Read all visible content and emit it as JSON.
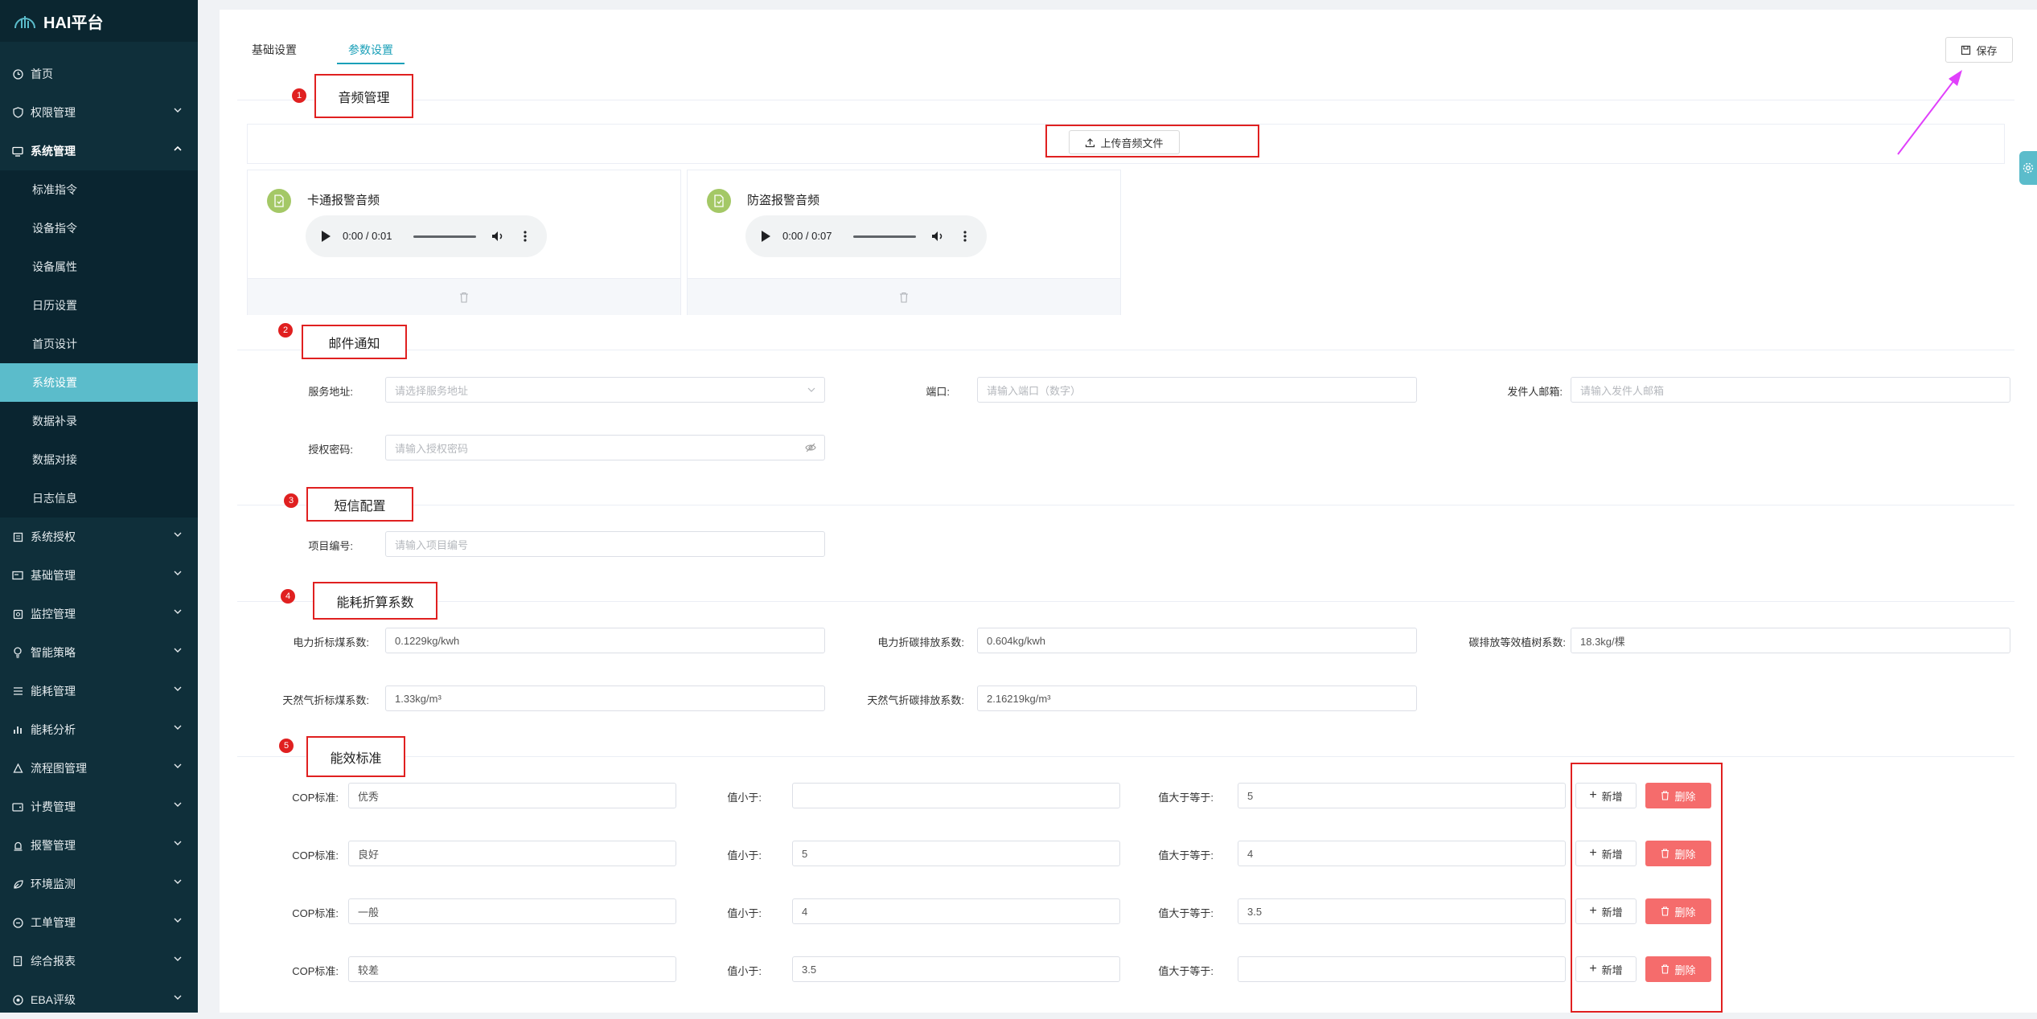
{
  "app": {
    "title": "HAI平台"
  },
  "sidebar": {
    "top_items": [
      {
        "label": "首页",
        "icon": "clock-icon"
      },
      {
        "label": "权限管理",
        "icon": "shield-icon"
      }
    ],
    "open_group": {
      "label": "系统管理",
      "icon": "monitor-icon"
    },
    "sub_items": [
      {
        "label": "标准指令",
        "active": false
      },
      {
        "label": "设备指令",
        "active": false
      },
      {
        "label": "设备属性",
        "active": false
      },
      {
        "label": "日历设置",
        "active": false
      },
      {
        "label": "首页设计",
        "active": false
      },
      {
        "label": "系统设置",
        "active": true
      },
      {
        "label": "数据补录",
        "active": false
      },
      {
        "label": "数据对接",
        "active": false
      },
      {
        "label": "日志信息",
        "active": false
      }
    ],
    "bottom_items": [
      {
        "label": "系统授权",
        "icon": "license-icon"
      },
      {
        "label": "基础管理",
        "icon": "card-icon"
      },
      {
        "label": "监控管理",
        "icon": "camera-icon"
      },
      {
        "label": "智能策略",
        "icon": "bulb-icon"
      },
      {
        "label": "能耗管理",
        "icon": "list-icon"
      },
      {
        "label": "能耗分析",
        "icon": "bar-chart-icon"
      },
      {
        "label": "流程图管理",
        "icon": "flow-icon"
      },
      {
        "label": "计费管理",
        "icon": "wallet-icon"
      },
      {
        "label": "报警管理",
        "icon": "alarm-icon"
      },
      {
        "label": "环境监测",
        "icon": "leaf-icon"
      },
      {
        "label": "工单管理",
        "icon": "ticket-icon"
      },
      {
        "label": "综合报表",
        "icon": "report-icon"
      },
      {
        "label": "EBA评级",
        "icon": "medal-icon"
      }
    ]
  },
  "tabs": [
    {
      "label": "基础设置",
      "active": false
    },
    {
      "label": "参数设置",
      "active": true
    }
  ],
  "toolbar": {
    "save_label": "保存"
  },
  "sections": {
    "audio": {
      "number": "1",
      "title": "音频管理",
      "upload_label": "上传音频文件",
      "files": [
        {
          "name": "卡通报警音频",
          "time": "0:00 / 0:01"
        },
        {
          "name": "防盗报警音频",
          "time": "0:00 / 0:07"
        }
      ]
    },
    "email": {
      "number": "2",
      "title": "邮件通知",
      "service_label": "服务地址:",
      "service_placeholder": "请选择服务地址",
      "port_label": "端口:",
      "port_placeholder": "请输入端口（数字）",
      "sender_label": "发件人邮箱:",
      "sender_placeholder": "请输入发件人邮箱",
      "auth_label": "授权密码:",
      "auth_placeholder": "请输入授权密码"
    },
    "sms": {
      "number": "3",
      "title": "短信配置",
      "project_label": "项目编号:",
      "project_placeholder": "请输入项目编号"
    },
    "energy": {
      "number": "4",
      "title": "能耗折算系数",
      "fields": [
        {
          "label": "电力折标煤系数:",
          "value": "0.1229kg/kwh"
        },
        {
          "label": "电力折碳排放系数:",
          "value": "0.604kg/kwh"
        },
        {
          "label": "碳排放等效植树系数:",
          "value": "18.3kg/棵"
        },
        {
          "label": "天然气折标煤系数:",
          "value": "1.33kg/m³"
        },
        {
          "label": "天然气折碳排放系数:",
          "value": "2.16219kg/m³"
        }
      ]
    },
    "efficiency": {
      "number": "5",
      "title": "能效标准",
      "cop_label": "COP标准:",
      "lt_label": "值小于:",
      "ge_label": "值大于等于:",
      "add_label": "新增",
      "delete_label": "删除",
      "rows": [
        {
          "cop": "优秀",
          "lt": "",
          "ge": "5"
        },
        {
          "cop": "良好",
          "lt": "5",
          "ge": "4"
        },
        {
          "cop": "一般",
          "lt": "4",
          "ge": "3.5"
        },
        {
          "cop": "较差",
          "lt": "3.5",
          "ge": ""
        }
      ]
    }
  },
  "colors": {
    "sidebar_bg": "#0f2f3a",
    "accent": "#5bbccb",
    "danger": "#f56c6c",
    "highlight": "#e02020",
    "arrow": "#e040fb"
  }
}
